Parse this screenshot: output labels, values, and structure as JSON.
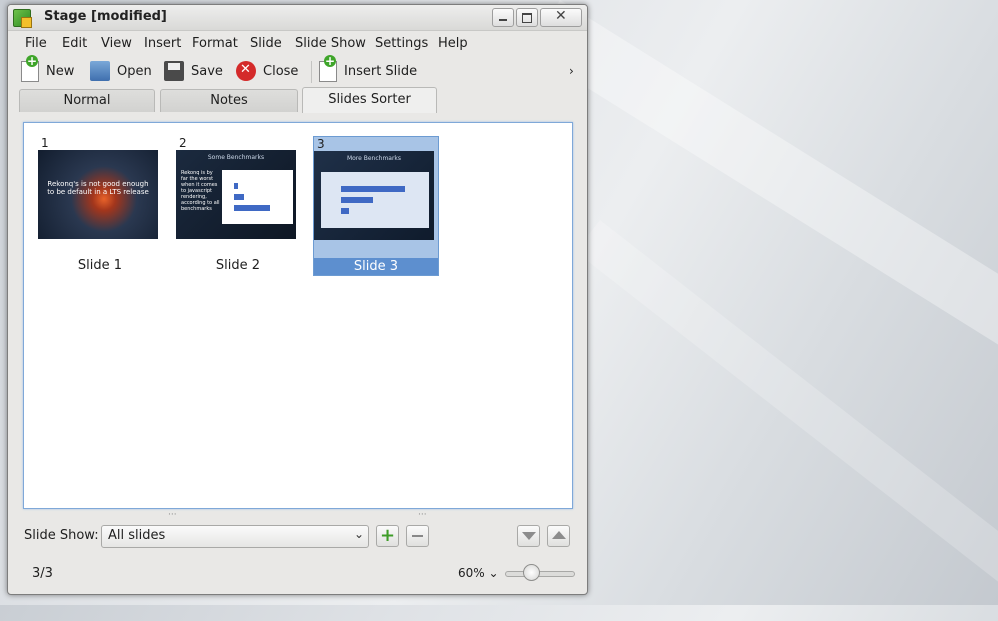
{
  "window": {
    "title": "Stage [modified]"
  },
  "menu": [
    "File",
    "Edit",
    "View",
    "Insert",
    "Format",
    "Slide",
    "Slide Show",
    "Settings",
    "Help"
  ],
  "toolbar": {
    "new_label": "New",
    "open_label": "Open",
    "save_label": "Save",
    "close_label": "Close",
    "insert_slide_label": "Insert Slide",
    "more_label": "›"
  },
  "tabs": [
    {
      "label": "Normal"
    },
    {
      "label": "Notes"
    },
    {
      "label": "Slides Sorter"
    }
  ],
  "slides": [
    {
      "number": "1",
      "label": "Slide 1",
      "content": "Rekonq's is not good enough to be default in a LTS release"
    },
    {
      "number": "2",
      "label": "Slide 2",
      "title": "Some Benchmarks",
      "content": "Rekonq is by far the worst when it comes to javascript rendering, according to all benchmarks"
    },
    {
      "number": "3",
      "label": "Slide 3",
      "title": "More Benchmarks"
    }
  ],
  "slideshow": {
    "label": "Slide Show:",
    "selected": "All slides"
  },
  "status": {
    "page": "3/3",
    "zoom": "60%"
  },
  "colors": {
    "selection": "#5d8fcf",
    "accent_green": "#3e9d28"
  }
}
